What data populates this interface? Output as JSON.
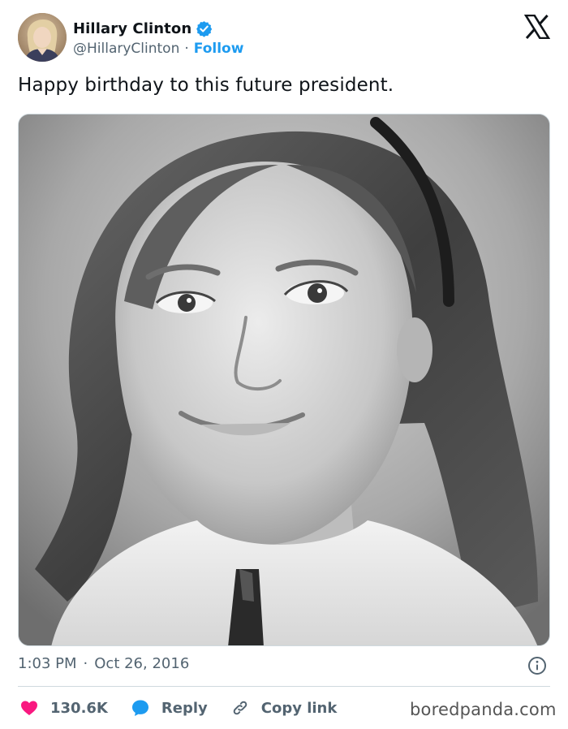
{
  "author": {
    "display_name": "Hillary Clinton",
    "handle": "@HillaryClinton",
    "separator": "·",
    "follow_label": "Follow",
    "verified": true
  },
  "tweet": {
    "text": "Happy birthday to this future president.",
    "photo_alt": "black-and-white childhood portrait",
    "time": "1:03 PM",
    "date_separator": "·",
    "date": "Oct 26, 2016"
  },
  "actions": {
    "likes_count": "130.6K",
    "reply_label": "Reply",
    "copy_link_label": "Copy link"
  },
  "watermark": "boredpanda.com",
  "colors": {
    "accent_blue": "#1d9bf0",
    "like_red": "#f91880",
    "muted_text": "#536471",
    "text": "#0f1419",
    "border": "#cfd9de"
  },
  "icons": {
    "brand": "x-logo-icon",
    "verified": "verified-badge-icon",
    "info": "info-icon",
    "like": "heart-icon",
    "reply": "speech-bubble-icon",
    "copy_link": "link-icon"
  }
}
